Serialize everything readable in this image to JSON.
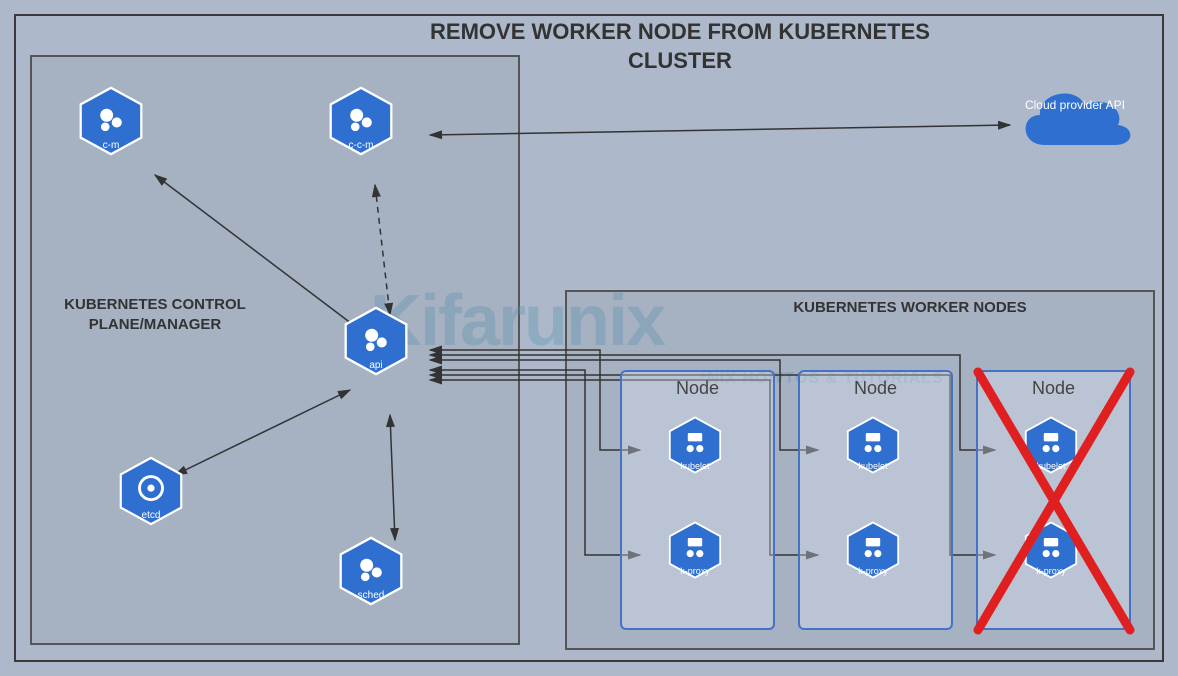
{
  "title": "REMOVE WORKER NODE FROM KUBERNETES CLUSTER",
  "control_plane": {
    "label": "KUBERNETES CONTROL PLANE/MANAGER",
    "components": {
      "cm": "c-m",
      "ccm": "c-c-m",
      "api": "api",
      "etcd": "etcd",
      "sched": "sched"
    }
  },
  "worker_nodes": {
    "label": "KUBERNETES WORKER NODES",
    "node_title": "Node",
    "components": {
      "kubelet": "kubelet",
      "kproxy": "k-proxy"
    },
    "nodes": [
      {
        "removed": false
      },
      {
        "removed": false
      },
      {
        "removed": true
      }
    ]
  },
  "cloud": {
    "label": "Cloud provider API"
  },
  "watermark": {
    "main": "Kifarunix",
    "sub": "*NIX HOWTOS & TUTORIALS"
  }
}
